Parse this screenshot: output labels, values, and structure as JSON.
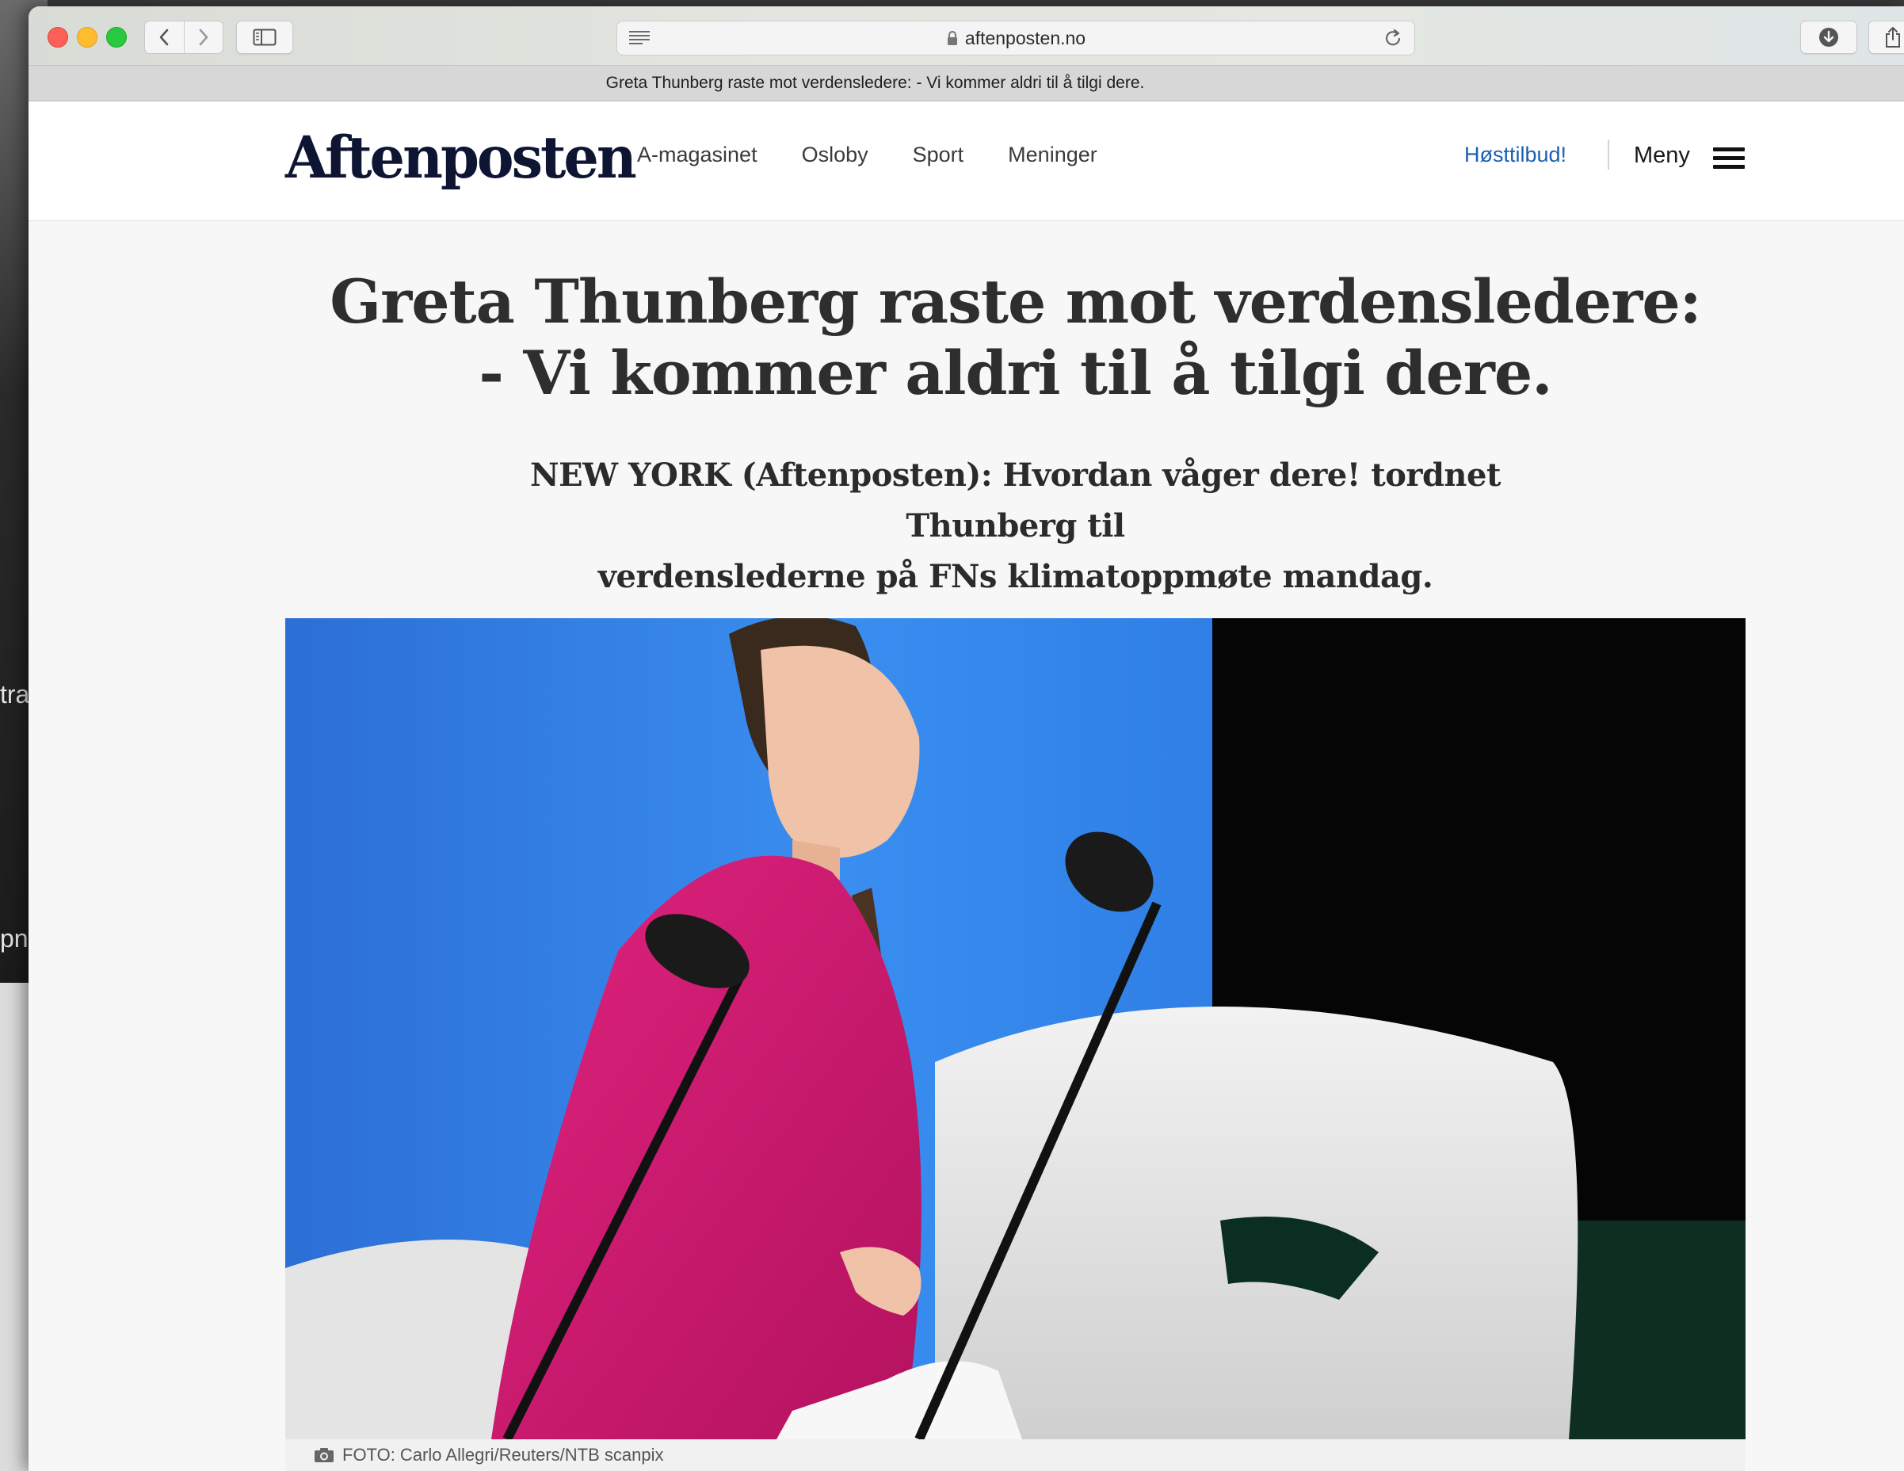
{
  "background_window": {
    "fragment_top": "tra",
    "fragment_bottom": "pn"
  },
  "browser": {
    "url": "aftenposten.no",
    "tab_title": "Greta Thunberg raste mot verdensledere: - Vi kommer aldri til å tilgi dere."
  },
  "site": {
    "logo": "Aftenposten",
    "nav": [
      "A-magasinet",
      "Osloby",
      "Sport",
      "Meninger"
    ],
    "offer": "Høsttilbud!",
    "menu_label": "Meny"
  },
  "article": {
    "headline_line1": "Greta Thunberg raste mot verdensledere:",
    "headline_line2": "- Vi kommer aldri til å tilgi dere.",
    "lede_line1": "NEW YORK (Aftenposten): Hvordan våger dere! tordnet Thunberg til",
    "lede_line2": "verdenslederne på FNs klimatoppmøte mandag.",
    "photo_caption": "FOTO: Carlo Allegri/Reuters/NTB scanpix"
  },
  "colors": {
    "brand_navy": "#0e1533",
    "offer_blue": "#1b5fb3",
    "headline": "#2e2e2e"
  }
}
